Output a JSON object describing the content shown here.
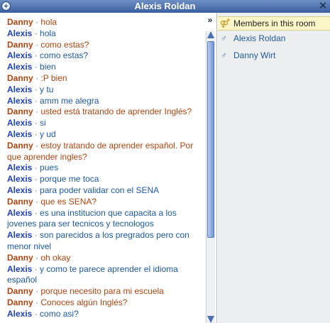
{
  "window": {
    "title": "Alexis Roldan",
    "close_glyph": "✕",
    "collapse_glyph": "»"
  },
  "members": {
    "header": "Members in this room",
    "header_icon": "members-icon",
    "items": [
      {
        "name": "Alexis Roldan",
        "icon": "male-icon"
      },
      {
        "name": "Danny Wirt",
        "icon": "male-icon"
      }
    ]
  },
  "messages": [
    {
      "sender": "Danny",
      "text": "hola",
      "who": "danny"
    },
    {
      "sender": "Alexis",
      "text": "hola",
      "who": "alexis"
    },
    {
      "sender": "Danny",
      "text": "como estas?",
      "who": "danny"
    },
    {
      "sender": "Alexis",
      "text": "como estas?",
      "who": "alexis"
    },
    {
      "sender": "Alexis",
      "text": "bien",
      "who": "alexis"
    },
    {
      "sender": "Danny",
      "text": ":P bien",
      "who": "danny"
    },
    {
      "sender": "Alexis",
      "text": "y tu",
      "who": "alexis"
    },
    {
      "sender": "Alexis",
      "text": "amm me alegra",
      "who": "alexis"
    },
    {
      "sender": "Danny",
      "text": "usted está tratando de aprender Inglés?",
      "who": "danny"
    },
    {
      "sender": "Alexis",
      "text": "si",
      "who": "alexis"
    },
    {
      "sender": "Alexis",
      "text": "y ud",
      "who": "alexis"
    },
    {
      "sender": "Danny",
      "text": "estoy tratando de aprender español. Por que aprender ingles?",
      "who": "danny"
    },
    {
      "sender": "Alexis",
      "text": "pues",
      "who": "alexis"
    },
    {
      "sender": "Alexis",
      "text": "porque me toca",
      "who": "alexis"
    },
    {
      "sender": "Alexis",
      "text": "para poder validar con el SENA",
      "who": "alexis"
    },
    {
      "sender": "Danny",
      "text": "que es SENA?",
      "who": "danny"
    },
    {
      "sender": "Alexis",
      "text": "es una institucion que capacita a los jovenes para ser tecnicos y tecnologos",
      "who": "alexis"
    },
    {
      "sender": "Alexis",
      "text": "son parecidos a los pregrados pero con menor nivel",
      "who": "alexis"
    },
    {
      "sender": "Danny",
      "text": "oh okay",
      "who": "danny"
    },
    {
      "sender": "Alexis",
      "text": "y como te parece aprender el idioma español",
      "who": "alexis"
    },
    {
      "sender": "Danny",
      "text": "porque necesito para mi escuela",
      "who": "danny"
    },
    {
      "sender": "Danny",
      "text": "Conoces algún Inglés?",
      "who": "danny"
    },
    {
      "sender": "Alexis",
      "text": "como asi?",
      "who": "alexis"
    }
  ],
  "separator": "·",
  "colors": {
    "danny": "#b3440e",
    "alexis": "#1c3fbf",
    "titlebar": "#3a5f9e",
    "members_header_bg": "#faf6c8"
  }
}
